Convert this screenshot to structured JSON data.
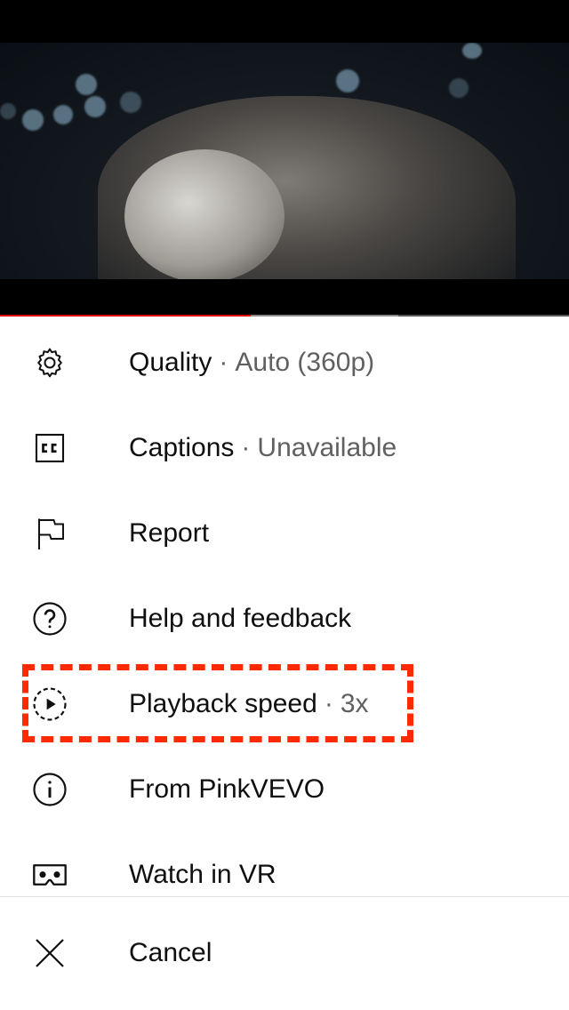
{
  "video": {
    "progress_played": 0.44,
    "progress_buffered": 0.7
  },
  "menu": {
    "items": [
      {
        "icon": "gear-icon",
        "label": "Quality",
        "value": "Auto (360p)"
      },
      {
        "icon": "captions-icon",
        "label": "Captions",
        "value": "Unavailable"
      },
      {
        "icon": "flag-icon",
        "label": "Report",
        "value": ""
      },
      {
        "icon": "help-icon",
        "label": "Help and feedback",
        "value": ""
      },
      {
        "icon": "playback-speed-icon",
        "label": "Playback speed",
        "value": "3x"
      },
      {
        "icon": "info-icon",
        "label": "From PinkVEVO",
        "value": ""
      },
      {
        "icon": "vr-icon",
        "label": "Watch in VR",
        "value": ""
      }
    ],
    "separator": "·",
    "cancel_label": "Cancel"
  },
  "colors": {
    "progress_played": "#e00000",
    "highlight": "#ff2a00",
    "text_primary": "#0f0f0f",
    "text_secondary": "#606060"
  }
}
